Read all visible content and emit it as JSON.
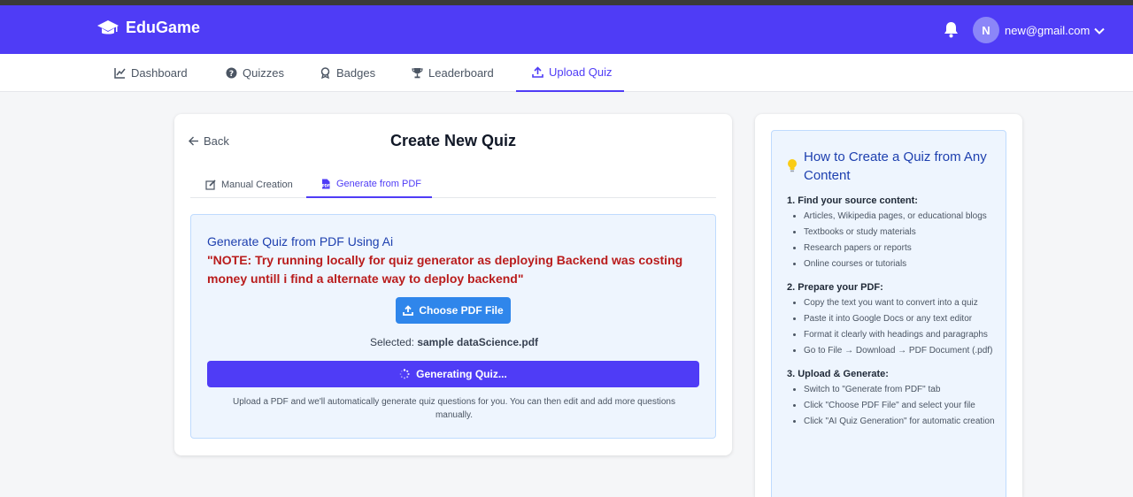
{
  "app": {
    "brand": "EduGame",
    "user_initial": "N",
    "user_email": "new@gmail.com"
  },
  "nav": [
    {
      "label": "Dashboard",
      "icon": "chart-line-icon"
    },
    {
      "label": "Quizzes",
      "icon": "question-circle-icon"
    },
    {
      "label": "Badges",
      "icon": "award-icon"
    },
    {
      "label": "Leaderboard",
      "icon": "trophy-icon"
    },
    {
      "label": "Upload Quiz",
      "icon": "upload-icon",
      "active": true
    }
  ],
  "main": {
    "back_label": "Back",
    "title": "Create New Quiz",
    "tabs": [
      {
        "label": "Manual Creation",
        "icon": "edit-icon"
      },
      {
        "label": "Generate from PDF",
        "icon": "file-pdf-icon",
        "active": true
      }
    ],
    "pdf": {
      "heading": "Generate Quiz from PDF Using Ai",
      "note": "\"NOTE: Try running locally for quiz generator as deploying Backend was costing money untill i find a alternate way to deploy backend\"",
      "choose_label": "Choose PDF File",
      "selected_prefix": "Selected:",
      "selected_file": "sample dataScience.pdf",
      "generate_label": "Generating Quiz...",
      "help_text": "Upload a PDF and we'll automatically generate quiz questions for you. You can then edit and add more questions manually."
    }
  },
  "guide": {
    "title": "How to Create a Quiz from Any Content",
    "steps": [
      {
        "title": "1. Find your source content:",
        "items": [
          "Articles, Wikipedia pages, or educational blogs",
          "Textbooks or study materials",
          "Research papers or reports",
          "Online courses or tutorials"
        ]
      },
      {
        "title": "2. Prepare your PDF:",
        "items": [
          "Copy the text you want to convert into a quiz",
          "Paste it into Google Docs or any text editor",
          "Format it clearly with headings and paragraphs",
          "Go to File → Download → PDF Document (.pdf)"
        ]
      },
      {
        "title": "3. Upload & Generate:",
        "items": [
          "Switch to \"Generate from PDF\" tab",
          "Click \"Choose PDF File\" and select your file",
          "Click \"AI Quiz Generation\" for automatic creation"
        ]
      }
    ]
  },
  "colors": {
    "brand": "#4f3cf6",
    "choose_button": "#2f86eb",
    "note": "#b91c1c",
    "heading": "#1e40af"
  }
}
